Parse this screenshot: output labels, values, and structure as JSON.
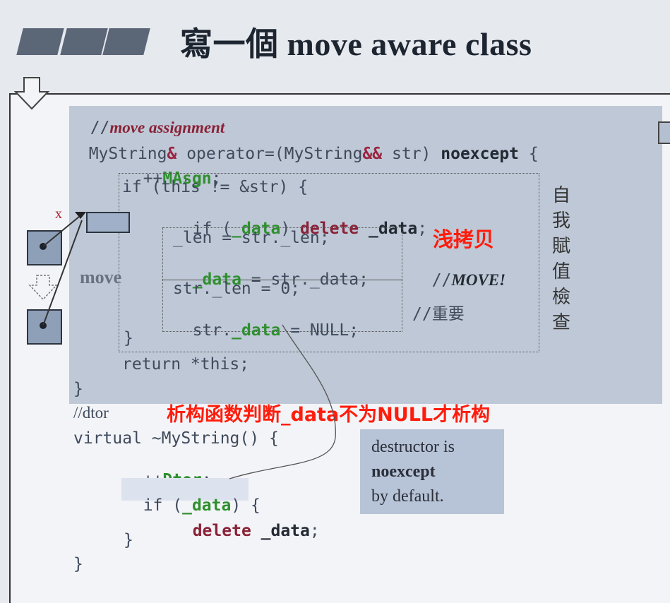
{
  "slide": {
    "title": "寫一個 move aware class"
  },
  "code": {
    "comment_move_assignment_prefix": "//",
    "comment_move_assignment": "move assignment",
    "signature_a": "MyString",
    "signature_amp1": "&",
    "signature_b": " operator=(MyString",
    "signature_amp2": "&&",
    "signature_c": " str) ",
    "signature_noexcept": "noexcept",
    "signature_brace": " {",
    "inc_prefix": "++",
    "inc_masgn": "MAsgn",
    "semicolon": ";",
    "if_this": "if (this != &str) {",
    "if_data_a": "if (",
    "if_data_var": "_data",
    "if_data_b": ") ",
    "if_data_delete": "delete",
    "if_data_c": " ",
    "if_data_var2": "_data",
    "if_data_semi": ";",
    "len_assign": "_len = str._len;",
    "data_assign_var": "_data",
    "data_assign_rest": " = str._data;",
    "comment_move_prefix": "//",
    "comment_move": "MOVE!",
    "len_zero": "str._len = 0;",
    "data_null_a": "str.",
    "data_null_var": "_data",
    "data_null_b": " = NULL;",
    "comment_important": "//重要",
    "close_brace_inner": "}",
    "return_this": "return *this;",
    "close_brace_func": "}",
    "comment_dtor": "//dtor",
    "dtor_sig": "virtual ~MyString() {",
    "inc_dtor_prefix": "++",
    "inc_dtor": "Dtor",
    "dtor_if_a": "if (",
    "dtor_if_var": "_data",
    "dtor_if_b": ") {",
    "dtor_delete": "delete",
    "dtor_delete_var": " _data",
    "dtor_delete_semi": ";",
    "dtor_close_inner": "}",
    "dtor_close": "}"
  },
  "diagram": {
    "move_label": "move",
    "x_mark": "x"
  },
  "side_label": [
    "自",
    "我",
    "賦",
    "值",
    "檢",
    "查"
  ],
  "annotations": {
    "shallow_copy": "浅拷贝",
    "dtor_note": "析构函数判断_data不为NULL才析构"
  },
  "note": {
    "line1": "destructor is",
    "line2": "noexcept",
    "line3": "by default."
  },
  "colors": {
    "shade": "#b4bfd0",
    "annotation_red": "#ff1c0c",
    "keyword_green": "#2f8f2f",
    "keyword_red": "#8a2136"
  }
}
